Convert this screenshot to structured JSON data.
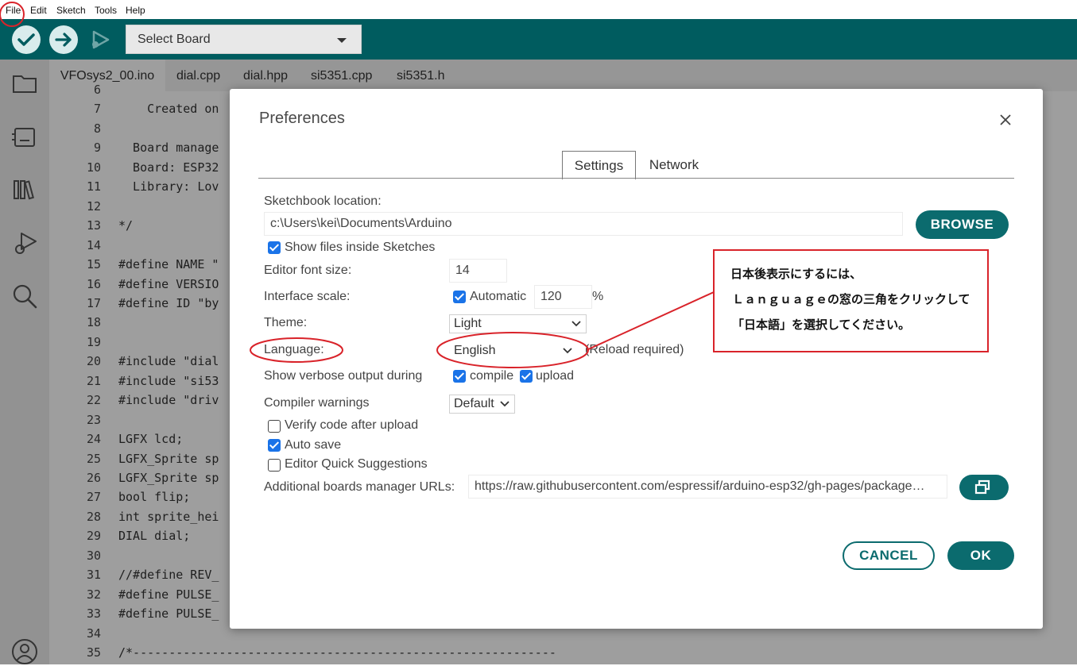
{
  "menu": [
    "File",
    "Edit",
    "Sketch",
    "Tools",
    "Help"
  ],
  "toolbar": {
    "verify_icon": "check-icon",
    "upload_icon": "arrow-right-icon",
    "debug_icon": "debug-icon",
    "board": "Select Board"
  },
  "colors": {
    "teal": "#005c5f",
    "accent": "#0b6b6e",
    "checkbox": "#1a73e8",
    "annotation_red": "#d9232a"
  },
  "sidebar_icons": [
    "folder-icon",
    "board-icon",
    "library-icon",
    "debug-icon",
    "search-icon",
    "account-icon"
  ],
  "tabs": [
    "VFOsys2_00.ino",
    "dial.cpp",
    "dial.hpp",
    "si5351.cpp",
    "si5351.h"
  ],
  "editor": {
    "line_numbers": [
      "6",
      "7",
      "8",
      "9",
      "10",
      "11",
      "12",
      "13",
      "14",
      "15",
      "16",
      "17",
      "18",
      "19",
      "20",
      "21",
      "22",
      "23",
      "24",
      "25",
      "26",
      "27",
      "28",
      "29",
      "30",
      "31",
      "32",
      "33",
      "34",
      "35"
    ],
    "lines": [
      "",
      "    Created on",
      "",
      "  Board manage",
      "  Board: ESP32",
      "  Library: Lov",
      "",
      "*/",
      "",
      "#define NAME \"",
      "#define VERSIO",
      "#define ID \"by",
      "",
      "",
      "#include \"dial",
      "#include \"si53",
      "#include \"driv",
      "",
      "LGFX lcd;",
      "LGFX_Sprite sp",
      "LGFX_Sprite sp",
      "bool flip;",
      "int sprite_hei",
      "DIAL dial;",
      "",
      "//#define REV_",
      "#define PULSE_",
      "#define PULSE_",
      "",
      "/*-----------------------------------------------------------"
    ]
  },
  "dialog": {
    "title": "Preferences",
    "tabs": [
      "Settings",
      "Network"
    ],
    "sketchbook_label": "Sketchbook location:",
    "sketchbook_path": "c:\\Users\\kei\\Documents\\Arduino",
    "browse": "BROWSE",
    "show_files": "Show files inside Sketches",
    "font_size_label": "Editor font size:",
    "font_size": "14",
    "scale_label": "Interface scale:",
    "automatic": "Automatic",
    "scale_value": "120",
    "percent": "%",
    "theme_label": "Theme:",
    "theme": "Light",
    "language_label": "Language:",
    "language": "English",
    "reload": "(Reload required)",
    "verbose_label": "Show verbose output during",
    "compile": "compile",
    "upload": "upload",
    "warnings_label": "Compiler warnings",
    "warnings": "Default",
    "verify_after": "Verify code after upload",
    "auto_save": "Auto save",
    "quick_suggestions": "Editor Quick Suggestions",
    "boards_label": "Additional boards manager URLs:",
    "boards_url": "https://raw.githubusercontent.com/espressif/arduino-esp32/gh-pages/package…",
    "cancel": "CANCEL",
    "ok": "OK"
  },
  "annotation": {
    "line1": "日本後表示にするには、",
    "line2": "Ｌａｎｇｕａｇｅの窓の三角をクリックして",
    "line3": "「日本語」を選択してください。"
  }
}
